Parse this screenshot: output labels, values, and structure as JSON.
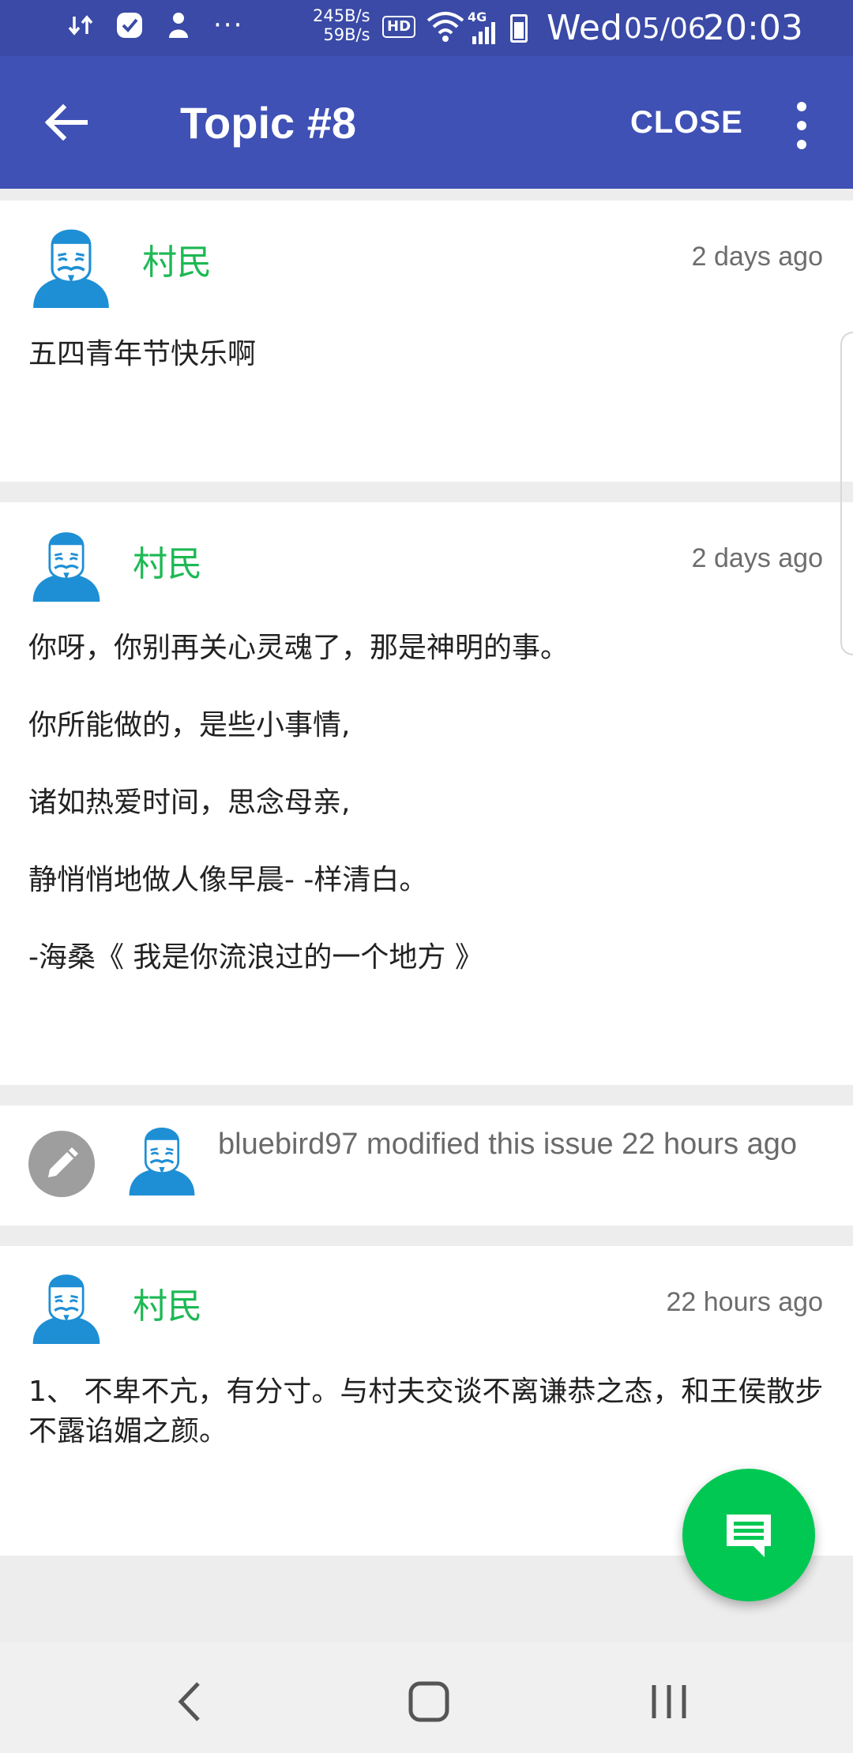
{
  "status_bar": {
    "net_up": "245B/s",
    "net_down": "59B/s",
    "hd": "HD",
    "network": "4G",
    "day": "Wed",
    "date": "05/06",
    "time": "20:03",
    "dots": "···"
  },
  "app_bar": {
    "title": "Topic #8",
    "close_label": "CLOSE"
  },
  "comments": [
    {
      "author": "村民",
      "time": "2 days ago",
      "lines": [
        "五四青年节快乐啊"
      ]
    },
    {
      "author": "村民",
      "time": "2 days ago",
      "lines": [
        "你呀，你别再关心灵魂了，那是神明的事。",
        "你所能做的，是些小事情,",
        "诸如热爱时间，思念母亲,",
        "静悄悄地做人像早晨- -样清白。",
        "-海桑《 我是你流浪过的一个地方 》"
      ]
    },
    {
      "author": "村民",
      "time": "22 hours ago",
      "lines": [
        "1、 不卑不亢，有分寸。与村夫交谈不离谦恭之态，和王侯散步不露谄媚之颜。"
      ]
    }
  ],
  "event": {
    "text": "bluebird97 modified this issue 22 hours ago",
    "icon": "pencil-icon"
  },
  "colors": {
    "status_bar": "#3a4aa6",
    "app_bar": "#3f51b5",
    "author": "#1db954",
    "fab": "#00c853",
    "avatar": "#1e8fd5"
  }
}
